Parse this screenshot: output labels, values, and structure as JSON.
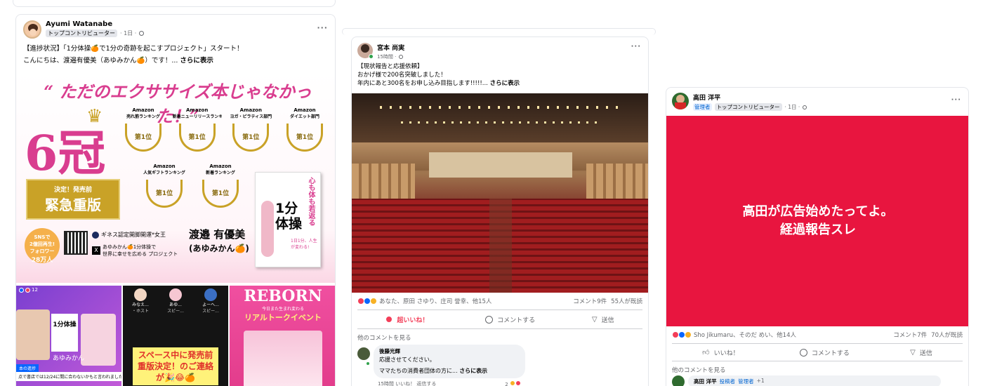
{
  "post1": {
    "author": "Ayumi Watanabe",
    "badge": "トップコントリビューター",
    "time": "· 1日 ·",
    "line1": "【進捗状況】「1分体操🍊で1分の奇跡を起こすプロジェクト」スタート！",
    "line2": "こんにちは、渡邉有優美（あゆみかん🍊）です！...",
    "see_more": "さらに表示",
    "banner": {
      "quote": "“ ただのエクササイズ本じゃなかった！”",
      "big": "6冠",
      "awards": [
        {
          "store": "Amazon",
          "cat": "売れ筋ランキング"
        },
        {
          "store": "Amazon",
          "cat": "新着ニューリリースランキング"
        },
        {
          "store": "Amazon",
          "cat": "ヨガ・ピラティス部門"
        },
        {
          "store": "Amazon",
          "cat": "ダイエット部門"
        },
        {
          "store": "Amazon",
          "cat": "人気ギフトランキング"
        },
        {
          "store": "Amazon",
          "cat": "新着ランキング"
        }
      ],
      "rank": "第1位",
      "decided": "決定！発売前",
      "reprint": "緊急重版",
      "sns": "SNSで",
      "sns2": "2億回再生!",
      "sns3": "フォロワー",
      "sns4": "28万人",
      "guinness": "ギネス認定開脚開運*女王",
      "project1": "あゆみかん🍊1分体操で",
      "project2": "世界に幸せを広める プロジェクト",
      "author_name": "渡邉 有優美",
      "author_alias": "(あゆみかん🍊)",
      "book_top": "心も体も若返る",
      "book_title": "1分体操",
      "book_sub": "1日1分、人生が変わる!"
    },
    "thumbs": {
      "count": "12",
      "t1_caption": "1分体操",
      "t1_name": "あゆみかん",
      "t1_bar": "本の進捗",
      "t1_note": "点で書店では12/24に間に合わないかもと言われました。",
      "t2_users": [
        {
          "name": "みなえ...",
          "role": "・ホスト"
        },
        {
          "name": "あゆ...",
          "role": "スピー..."
        },
        {
          "name": "よーへ...",
          "role": "スピー..."
        }
      ],
      "t2_text": "スペース中に発売前重版決定！のご連絡が🎉😂🍊",
      "t3_title": "REBORN",
      "t3_sub": "今日また生まれ変わる",
      "t3_event": "リアルトークイベント"
    }
  },
  "post2": {
    "author": "宮本 尚実",
    "time": "15時間 ·",
    "line1": "【現状報告と応援依頼】",
    "line2": "おかげ様で200名突破しました！",
    "line3": "年内にあと300名をお申し込み目指します!!!!!...",
    "see_more": "さらに表示",
    "reactions_text": "あなた、原田 さゆり、庄司 誉幸、他15人",
    "comments_count": "コメント9件",
    "views": "55人が既読",
    "like_label": "超いいね！",
    "comment_label": "コメントする",
    "send_label": "送信",
    "view_more": "他のコメントを見る",
    "comment": {
      "author": "後藤光輝",
      "line1": "応援させてください。",
      "line2": "ママたちの消費者団体の方に...",
      "see_more": "さらに表示",
      "meta": "15時間  いいね！  返信する",
      "react_count": "2"
    }
  },
  "post3": {
    "author": "高田 洋平",
    "admin_badge": "管理者",
    "badge": "トップコントリビューター",
    "time": "· 1日 ·",
    "banner_line1": "高田が広告始めたってよ。",
    "banner_line2": "経過報告スレ",
    "reactions_text": "Sho Jikumaru、そのだ めい、他14人",
    "comments_count": "コメント7件",
    "views": "70人が既読",
    "like_label": "いいね！",
    "comment_label": "コメントする",
    "send_label": "送信",
    "view_more": "他のコメントを見る",
    "reply_author": "高田 洋平",
    "reply_badge1": "投稿者",
    "reply_badge2": "管理者",
    "reply_plus": "+1"
  },
  "colors": {
    "red_banner": "#e8153f",
    "blue": "#0866ff",
    "love": "#f33e58",
    "gold": "#c9a227",
    "pink": "#d93d8f"
  }
}
